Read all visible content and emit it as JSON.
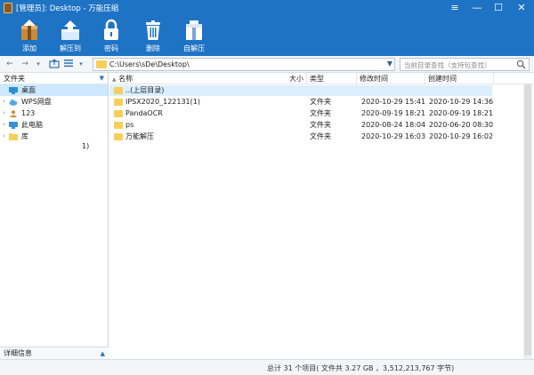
{
  "window": {
    "title": "[管理员]: Desktop - 万能压缩"
  },
  "toolbar": {
    "buttons": [
      {
        "label": "添加"
      },
      {
        "label": "解压到"
      },
      {
        "label": "密码"
      },
      {
        "label": "删除"
      },
      {
        "label": "自解压"
      }
    ]
  },
  "address": {
    "path": "C:\\Users\\sDe\\Desktop\\",
    "search_placeholder": "当前目录查找（支持包查找）"
  },
  "left_pane": {
    "header": "文件夹",
    "tree": [
      {
        "label": "桌面"
      },
      {
        "label": "WPS网盘"
      },
      {
        "label": "123"
      },
      {
        "label": "此电脑"
      },
      {
        "label": "库"
      }
    ],
    "extra": "1)",
    "detail_label": "详细信息"
  },
  "columns": {
    "name": "名称",
    "size": "大小",
    "type": "类型",
    "modified": "修改时间",
    "created": "创建时间"
  },
  "files": [
    {
      "name": "..(上层目录)",
      "size": "",
      "type": "",
      "modified": "",
      "created": ""
    },
    {
      "name": "IPSX2020_122131(1)",
      "size": "",
      "type": "文件夹",
      "modified": "2020-10-29 15:41",
      "created": "2020-10-29 14:36"
    },
    {
      "name": "PandaOCR",
      "size": "",
      "type": "文件夹",
      "modified": "2020-09-19 18:21",
      "created": "2020-09-19 18:21"
    },
    {
      "name": "ps",
      "size": "",
      "type": "文件夹",
      "modified": "2020-08-24 18:04",
      "created": "2020-06-20 08:30"
    },
    {
      "name": "万能解压",
      "size": "",
      "type": "文件夹",
      "modified": "2020-10-29 16:03",
      "created": "2020-10-29 16:02"
    }
  ],
  "status": {
    "text": "总计 31 个项目( 文件共 3.27 GB ，3,512,213,767 字节)"
  },
  "colors": {
    "toolbar": "#1e73c5",
    "selection": "#cde8ff",
    "folder": "#f7cf58"
  }
}
